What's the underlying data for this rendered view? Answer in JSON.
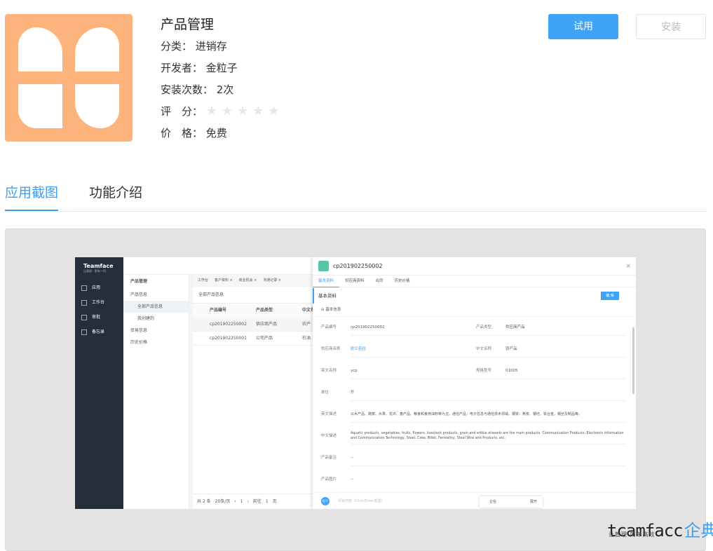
{
  "app": {
    "title": "产品管理",
    "category_label": "分类：",
    "category": "进销存",
    "developer_label": "开发者：",
    "developer": "金粒子",
    "installs_label": "安装次数：",
    "installs": "2次",
    "rating_label": "评　分：",
    "rating": 0,
    "rating_max": 5,
    "price_label": "价　格：",
    "price": "免费",
    "icon_color": "#fdb47c"
  },
  "actions": {
    "try_label": "试用",
    "install_label": "安装"
  },
  "tabs": [
    {
      "label": "应用截图",
      "active": true
    },
    {
      "label": "功能介绍",
      "active": false
    }
  ],
  "screenshot": {
    "brand": "Teamface",
    "brand_sub": "让管理 · 更有一切",
    "nav": [
      "应用",
      "工作台",
      "审批",
      "备忘录"
    ],
    "module_title": "产品管理",
    "tree": [
      "产品信息",
      "全部产品信息",
      "我创建的",
      "贸易信息",
      "历史价格"
    ],
    "open_tabs": [
      "工作台",
      "客户资料 ×",
      "商业机会 ×",
      "沟通记录 ×"
    ],
    "list_title": "全部产品信息",
    "list_columns": [
      "产品编号",
      "产品类型",
      "中文名"
    ],
    "list_rows": [
      [
        "cp201902250002",
        "供应商产品",
        "农产"
      ],
      [
        "cp201902250001",
        "公司产品",
        "石油"
      ]
    ],
    "pager": "共 2 条　20条/页　‹　1　›　前往　1　页",
    "detail": {
      "title": "cp201902250002",
      "close": "×",
      "tabs": [
        "基本资料",
        "供应商资料",
        "合同",
        "历史价格"
      ],
      "section": "基本资料",
      "edit": "编 辑",
      "group": "基本信息",
      "fields": [
        {
          "l1": "产品编号",
          "v1": "cp201902250002",
          "l2": "产品类型",
          "v2": "供应商产品"
        },
        {
          "l1": "供应商名称",
          "v1": "欧兰若拉",
          "l2": "中文名称",
          "v2": "农产品"
        },
        {
          "l1": "英文名称",
          "v1": "ycp",
          "l2": "规格型号",
          "v2": "01005"
        },
        {
          "l1": "单位",
          "v1": "升",
          "l2": "",
          "v2": ""
        },
        {
          "l1": "英文描述",
          "v1": "以水产品、蔬菜、水果、花卉、畜产品、粮食和食用油籽等为主。通信产品：电子信息与通信技术领域。钢铁：焦炭、钢坯、铁合金、钢丝及制品等。"
        },
        {
          "l1": "中文描述",
          "v1": "Aquatic products, vegetables, fruits, flowers, livestock products, grain and edible oilseeds are the main products. Communication Products: Electronic Information and Communication Technology, Steel: Coke, Billet, Ferroalloy, Steel Wire and Products, etc."
        },
        {
          "l1": "产品备注",
          "v1": "--"
        },
        {
          "l1": "产品图片",
          "v1": "--"
        }
      ],
      "comment_avatar": "粒子",
      "comment_placeholder": "评论内容（Ctrl+Enter发送）",
      "float_label": "企信",
      "float_action": "展开"
    }
  },
  "watermark": {
    "en": "tcamfacc",
    "cn": "企典",
    "sub": "让管理·简单高效"
  }
}
